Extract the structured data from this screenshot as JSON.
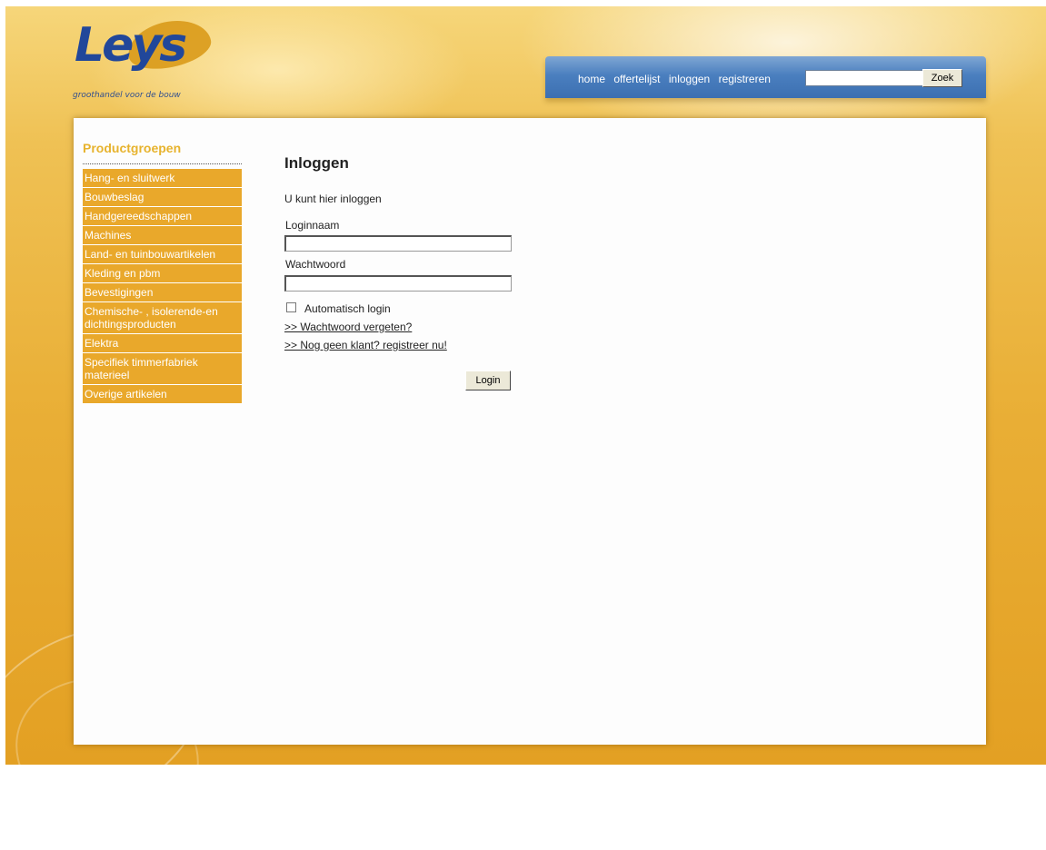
{
  "brand": {
    "logo_text": "Leys",
    "tagline": "groothandel voor de bouw",
    "colors": {
      "gold": "#e9a82b",
      "blue": "#21479a",
      "nav_blue": "#4a7fbf"
    }
  },
  "nav": {
    "links": [
      "home",
      "offertelijst",
      "inloggen",
      "registreren"
    ],
    "search_value": "",
    "search_button": "Zoek"
  },
  "sidebar": {
    "title": "Productgroepen",
    "items": [
      "Hang- en sluitwerk",
      "Bouwbeslag",
      "Handgereedschappen",
      "Machines",
      "Land- en tuinbouwartikelen",
      "Kleding en pbm",
      "Bevestigingen",
      "Chemische- , isolerende-en dichtingsproducten",
      "Elektra",
      "Specifiek timmerfabriek materieel",
      "Overige artikelen"
    ]
  },
  "login": {
    "title": "Inloggen",
    "intro": "U kunt hier inloggen",
    "username_label": "Loginnaam",
    "username_value": "",
    "password_label": "Wachtwoord",
    "password_value": "",
    "auto_login_label": "Automatisch login",
    "auto_login_checked": false,
    "forgot_link": ">> Wachtwoord vergeten?",
    "register_link": ">> Nog geen klant? registreer nu!",
    "submit_label": "Login"
  }
}
